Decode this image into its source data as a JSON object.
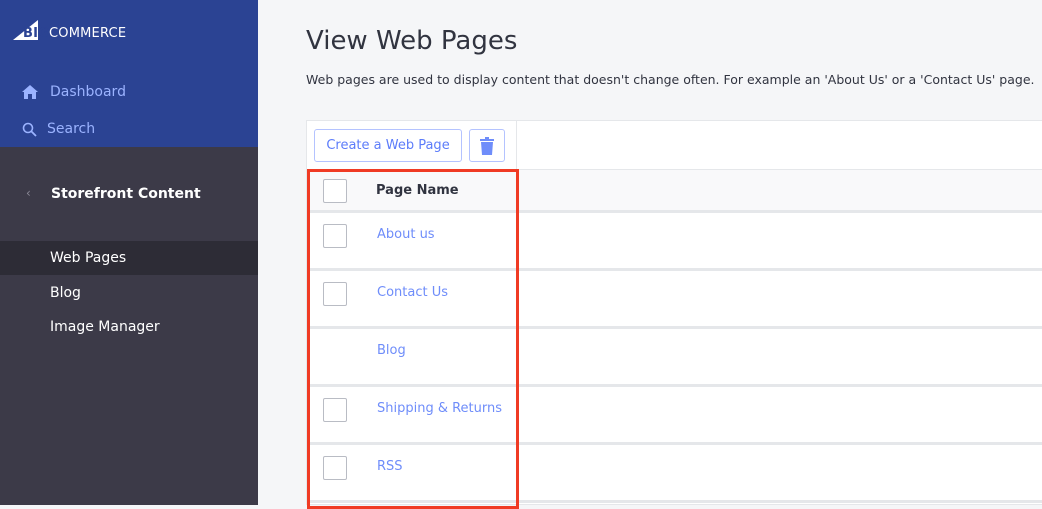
{
  "brand": {
    "logo_text": "BIGCOMMERCE"
  },
  "sidebar": {
    "top_items": [
      {
        "label": "Dashboard",
        "icon": "home-icon"
      },
      {
        "label": "Search",
        "icon": "search-icon"
      }
    ],
    "section": "Storefront Content",
    "items": [
      {
        "label": "Web Pages",
        "active": true
      },
      {
        "label": "Blog"
      },
      {
        "label": "Image Manager"
      }
    ]
  },
  "main": {
    "title": "View Web Pages",
    "description": "Web pages are used to display content that doesn't change often. For example an 'About Us' or a 'Contact Us' page.",
    "create_label": "Create a Web Page",
    "column_header": "Page Name",
    "rows": [
      {
        "name": "About us",
        "checkbox": true
      },
      {
        "name": "Contact Us",
        "checkbox": true
      },
      {
        "name": "Blog",
        "checkbox": false
      },
      {
        "name": "Shipping & Returns",
        "checkbox": true
      },
      {
        "name": "RSS",
        "checkbox": true
      }
    ]
  },
  "colors": {
    "sidebar_top": "#2b4393",
    "sidebar": "#3c3a48",
    "link": "#6f8dfa",
    "highlight": "#f03b24"
  }
}
